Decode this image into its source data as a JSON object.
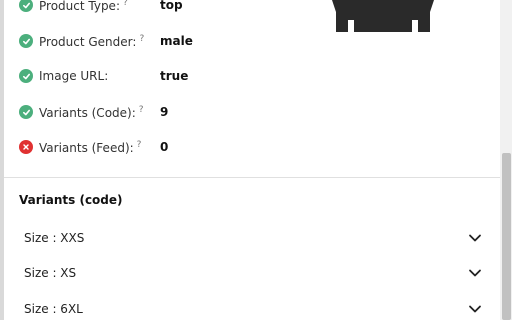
{
  "attributes": [
    {
      "label": "Product Type:",
      "help": "?",
      "value": "top",
      "status": "ok"
    },
    {
      "label": "Product Gender:",
      "help": "?",
      "value": "male",
      "status": "ok"
    },
    {
      "label": "Image URL:",
      "help": "",
      "value": "true",
      "status": "ok"
    },
    {
      "label": "Variants (Code):",
      "help": "?",
      "value": "9",
      "status": "ok"
    },
    {
      "label": "Variants (Feed):",
      "help": "?",
      "value": "0",
      "status": "error"
    }
  ],
  "variants": {
    "title": "Variants (code)",
    "items": [
      {
        "label": "Size : XXS"
      },
      {
        "label": "Size : XS"
      },
      {
        "label": "Size : 6XL"
      }
    ]
  },
  "colors": {
    "ok": "#4caf7d",
    "error": "#e03131"
  }
}
